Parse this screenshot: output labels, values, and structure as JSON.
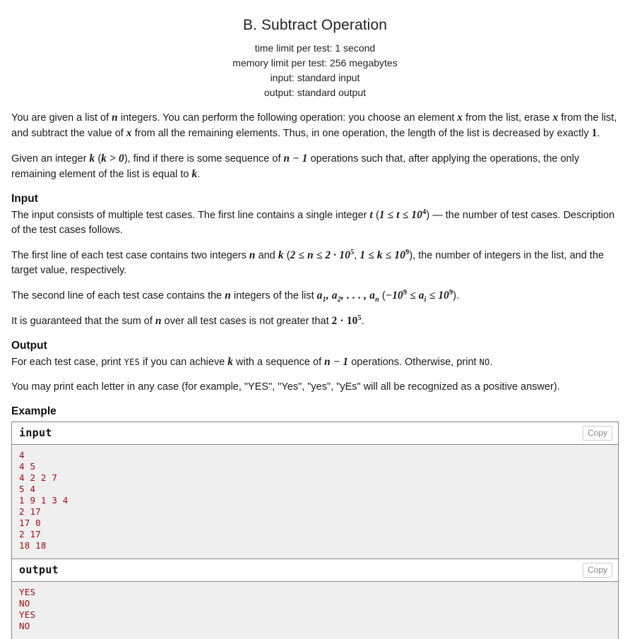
{
  "problem": {
    "title": "B. Subtract Operation",
    "limits": [
      "time limit per test: 1 second",
      "memory limit per test: 256 megabytes",
      "input: standard input",
      "output: standard output"
    ]
  },
  "statement": {
    "p1_a": "You are given a list of ",
    "p1_m1": "n",
    "p1_b": " integers. You can perform the following operation: you choose an element ",
    "p1_m2": "x",
    "p1_c": " from the list, erase ",
    "p1_m3": "x",
    "p1_d": " from the list, and subtract the value of ",
    "p1_m4": "x",
    "p1_e": " from all the remaining elements. Thus, in one operation, the length of the list is decreased by exactly ",
    "p1_m5": "1",
    "p1_f": ".",
    "p2_a": "Given an integer ",
    "p2_m1": "k",
    "p2_b": " (",
    "p2_m2": "k > 0",
    "p2_c": "), find if there is some sequence of ",
    "p2_m3": "n − 1",
    "p2_d": " operations such that, after applying the operations, the only remaining element of the list is equal to ",
    "p2_m4": "k",
    "p2_e": "."
  },
  "input_section": {
    "heading": "Input",
    "p1_a": "The input consists of multiple test cases. The first line contains a single integer ",
    "p1_m1": "t",
    "p1_b": " (",
    "p1_m2_lhs": "1 ≤ t ≤ 10",
    "p1_m2_exp": "4",
    "p1_c": ") — the number of test cases. Description of the test cases follows.",
    "p2_a": "The first line of each test case contains two integers ",
    "p2_m1": "n",
    "p2_b": " and ",
    "p2_m2": "k",
    "p2_c": " (",
    "p2_m3_lhs": "2 ≤ n ≤ 2 · 10",
    "p2_m3_exp": "5",
    "p2_m3_sep": ", ",
    "p2_m4_lhs": "1 ≤ k ≤ 10",
    "p2_m4_exp": "9",
    "p2_d": "), the number of integers in the list, and the target value, respectively.",
    "p3_a": "The second line of each test case contains the ",
    "p3_m1": "n",
    "p3_b": " integers of the list ",
    "p3_m2_a": "a",
    "p3_m2_sub1": "1",
    "p3_m2_b": ", a",
    "p3_m2_sub2": "2",
    "p3_m2_c": ", . . . , a",
    "p3_m2_sub3": "n",
    "p3_c": " (",
    "p3_m3_a": "−10",
    "p3_m3_exp1": "9",
    "p3_m3_b": " ≤ a",
    "p3_m3_sub": "i",
    "p3_m3_c": " ≤ 10",
    "p3_m3_exp2": "9",
    "p3_d": ").",
    "p4_a": "It is guaranteed that the sum of ",
    "p4_m1": "n",
    "p4_b": " over all test cases is not greater that ",
    "p4_m2_lhs": "2 · 10",
    "p4_m2_exp": "5",
    "p4_c": "."
  },
  "output_section": {
    "heading": "Output",
    "p1_a": "For each test case, print ",
    "p1_tt1": "YES",
    "p1_b": " if you can achieve ",
    "p1_m1": "k",
    "p1_c": " with a sequence of ",
    "p1_m2": "n − 1",
    "p1_d": " operations. Otherwise, print ",
    "p1_tt2": "NO",
    "p1_e": ".",
    "p2": "You may print each letter in any case (for example, \"YES\", \"Yes\", \"yes\", \"yEs\" will all be recognized as a positive answer)."
  },
  "example": {
    "heading": "Example",
    "input_label": "input",
    "output_label": "output",
    "copy_label": "Copy",
    "input_text": "4\n4 5\n4 2 2 7\n5 4\n1 9 1 3 4\n2 17\n17 0\n2 17\n18 18",
    "output_text": "YES\nNO\nYES\nNO"
  },
  "colors": {
    "sample_text": "#9e0b0b",
    "sample_bg": "#efefef",
    "border": "#888888",
    "copy_border": "#cccccc",
    "copy_text": "#888888"
  }
}
